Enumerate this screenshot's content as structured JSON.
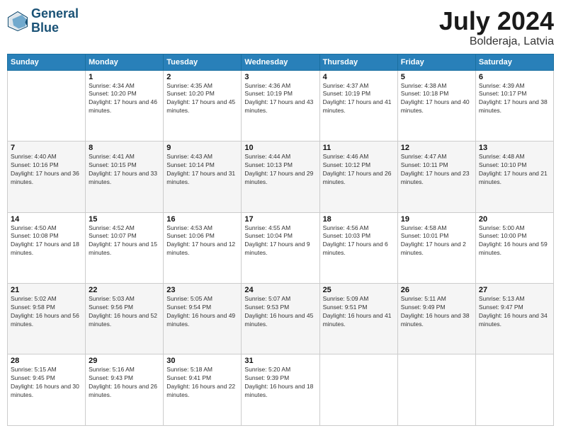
{
  "header": {
    "logo_line1": "General",
    "logo_line2": "Blue",
    "month": "July 2024",
    "location": "Bolderaja, Latvia"
  },
  "weekdays": [
    "Sunday",
    "Monday",
    "Tuesday",
    "Wednesday",
    "Thursday",
    "Friday",
    "Saturday"
  ],
  "weeks": [
    [
      {
        "day": "",
        "sunrise": "",
        "sunset": "",
        "daylight": ""
      },
      {
        "day": "1",
        "sunrise": "Sunrise: 4:34 AM",
        "sunset": "Sunset: 10:20 PM",
        "daylight": "Daylight: 17 hours and 46 minutes."
      },
      {
        "day": "2",
        "sunrise": "Sunrise: 4:35 AM",
        "sunset": "Sunset: 10:20 PM",
        "daylight": "Daylight: 17 hours and 45 minutes."
      },
      {
        "day": "3",
        "sunrise": "Sunrise: 4:36 AM",
        "sunset": "Sunset: 10:19 PM",
        "daylight": "Daylight: 17 hours and 43 minutes."
      },
      {
        "day": "4",
        "sunrise": "Sunrise: 4:37 AM",
        "sunset": "Sunset: 10:19 PM",
        "daylight": "Daylight: 17 hours and 41 minutes."
      },
      {
        "day": "5",
        "sunrise": "Sunrise: 4:38 AM",
        "sunset": "Sunset: 10:18 PM",
        "daylight": "Daylight: 17 hours and 40 minutes."
      },
      {
        "day": "6",
        "sunrise": "Sunrise: 4:39 AM",
        "sunset": "Sunset: 10:17 PM",
        "daylight": "Daylight: 17 hours and 38 minutes."
      }
    ],
    [
      {
        "day": "7",
        "sunrise": "Sunrise: 4:40 AM",
        "sunset": "Sunset: 10:16 PM",
        "daylight": "Daylight: 17 hours and 36 minutes."
      },
      {
        "day": "8",
        "sunrise": "Sunrise: 4:41 AM",
        "sunset": "Sunset: 10:15 PM",
        "daylight": "Daylight: 17 hours and 33 minutes."
      },
      {
        "day": "9",
        "sunrise": "Sunrise: 4:43 AM",
        "sunset": "Sunset: 10:14 PM",
        "daylight": "Daylight: 17 hours and 31 minutes."
      },
      {
        "day": "10",
        "sunrise": "Sunrise: 4:44 AM",
        "sunset": "Sunset: 10:13 PM",
        "daylight": "Daylight: 17 hours and 29 minutes."
      },
      {
        "day": "11",
        "sunrise": "Sunrise: 4:46 AM",
        "sunset": "Sunset: 10:12 PM",
        "daylight": "Daylight: 17 hours and 26 minutes."
      },
      {
        "day": "12",
        "sunrise": "Sunrise: 4:47 AM",
        "sunset": "Sunset: 10:11 PM",
        "daylight": "Daylight: 17 hours and 23 minutes."
      },
      {
        "day": "13",
        "sunrise": "Sunrise: 4:48 AM",
        "sunset": "Sunset: 10:10 PM",
        "daylight": "Daylight: 17 hours and 21 minutes."
      }
    ],
    [
      {
        "day": "14",
        "sunrise": "Sunrise: 4:50 AM",
        "sunset": "Sunset: 10:08 PM",
        "daylight": "Daylight: 17 hours and 18 minutes."
      },
      {
        "day": "15",
        "sunrise": "Sunrise: 4:52 AM",
        "sunset": "Sunset: 10:07 PM",
        "daylight": "Daylight: 17 hours and 15 minutes."
      },
      {
        "day": "16",
        "sunrise": "Sunrise: 4:53 AM",
        "sunset": "Sunset: 10:06 PM",
        "daylight": "Daylight: 17 hours and 12 minutes."
      },
      {
        "day": "17",
        "sunrise": "Sunrise: 4:55 AM",
        "sunset": "Sunset: 10:04 PM",
        "daylight": "Daylight: 17 hours and 9 minutes."
      },
      {
        "day": "18",
        "sunrise": "Sunrise: 4:56 AM",
        "sunset": "Sunset: 10:03 PM",
        "daylight": "Daylight: 17 hours and 6 minutes."
      },
      {
        "day": "19",
        "sunrise": "Sunrise: 4:58 AM",
        "sunset": "Sunset: 10:01 PM",
        "daylight": "Daylight: 17 hours and 2 minutes."
      },
      {
        "day": "20",
        "sunrise": "Sunrise: 5:00 AM",
        "sunset": "Sunset: 10:00 PM",
        "daylight": "Daylight: 16 hours and 59 minutes."
      }
    ],
    [
      {
        "day": "21",
        "sunrise": "Sunrise: 5:02 AM",
        "sunset": "Sunset: 9:58 PM",
        "daylight": "Daylight: 16 hours and 56 minutes."
      },
      {
        "day": "22",
        "sunrise": "Sunrise: 5:03 AM",
        "sunset": "Sunset: 9:56 PM",
        "daylight": "Daylight: 16 hours and 52 minutes."
      },
      {
        "day": "23",
        "sunrise": "Sunrise: 5:05 AM",
        "sunset": "Sunset: 9:54 PM",
        "daylight": "Daylight: 16 hours and 49 minutes."
      },
      {
        "day": "24",
        "sunrise": "Sunrise: 5:07 AM",
        "sunset": "Sunset: 9:53 PM",
        "daylight": "Daylight: 16 hours and 45 minutes."
      },
      {
        "day": "25",
        "sunrise": "Sunrise: 5:09 AM",
        "sunset": "Sunset: 9:51 PM",
        "daylight": "Daylight: 16 hours and 41 minutes."
      },
      {
        "day": "26",
        "sunrise": "Sunrise: 5:11 AM",
        "sunset": "Sunset: 9:49 PM",
        "daylight": "Daylight: 16 hours and 38 minutes."
      },
      {
        "day": "27",
        "sunrise": "Sunrise: 5:13 AM",
        "sunset": "Sunset: 9:47 PM",
        "daylight": "Daylight: 16 hours and 34 minutes."
      }
    ],
    [
      {
        "day": "28",
        "sunrise": "Sunrise: 5:15 AM",
        "sunset": "Sunset: 9:45 PM",
        "daylight": "Daylight: 16 hours and 30 minutes."
      },
      {
        "day": "29",
        "sunrise": "Sunrise: 5:16 AM",
        "sunset": "Sunset: 9:43 PM",
        "daylight": "Daylight: 16 hours and 26 minutes."
      },
      {
        "day": "30",
        "sunrise": "Sunrise: 5:18 AM",
        "sunset": "Sunset: 9:41 PM",
        "daylight": "Daylight: 16 hours and 22 minutes."
      },
      {
        "day": "31",
        "sunrise": "Sunrise: 5:20 AM",
        "sunset": "Sunset: 9:39 PM",
        "daylight": "Daylight: 16 hours and 18 minutes."
      },
      {
        "day": "",
        "sunrise": "",
        "sunset": "",
        "daylight": ""
      },
      {
        "day": "",
        "sunrise": "",
        "sunset": "",
        "daylight": ""
      },
      {
        "day": "",
        "sunrise": "",
        "sunset": "",
        "daylight": ""
      }
    ]
  ]
}
